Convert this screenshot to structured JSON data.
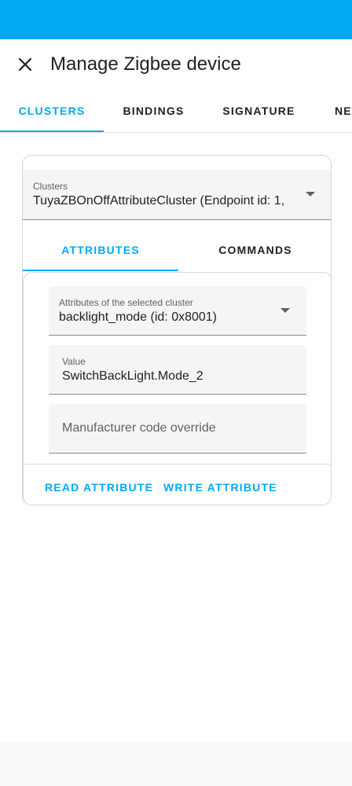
{
  "header": {
    "title": "Manage Zigbee device",
    "close_icon": "close-icon"
  },
  "tabs": [
    {
      "label": "CLUSTERS",
      "active": true
    },
    {
      "label": "BINDINGS",
      "active": false
    },
    {
      "label": "SIGNATURE",
      "active": false
    },
    {
      "label": "NE",
      "active": false
    }
  ],
  "cluster_select": {
    "label": "Clusters",
    "value": "TuyaZBOnOffAttributeCluster (Endpoint id: 1,"
  },
  "subtabs": [
    {
      "label": "ATTRIBUTES",
      "active": true
    },
    {
      "label": "COMMANDS",
      "active": false
    }
  ],
  "attribute_select": {
    "label": "Attributes of the selected cluster",
    "value": "backlight_mode (id: 0x8001)"
  },
  "value_field": {
    "label": "Value",
    "value": "SwitchBackLight.Mode_2"
  },
  "manufacturer_field": {
    "placeholder": "Manufacturer code override"
  },
  "actions": {
    "read": "READ ATTRIBUTE",
    "write": "WRITE ATTRIBUTE"
  },
  "colors": {
    "accent": "#03a9f4",
    "status_bar": "#03a9f4"
  }
}
